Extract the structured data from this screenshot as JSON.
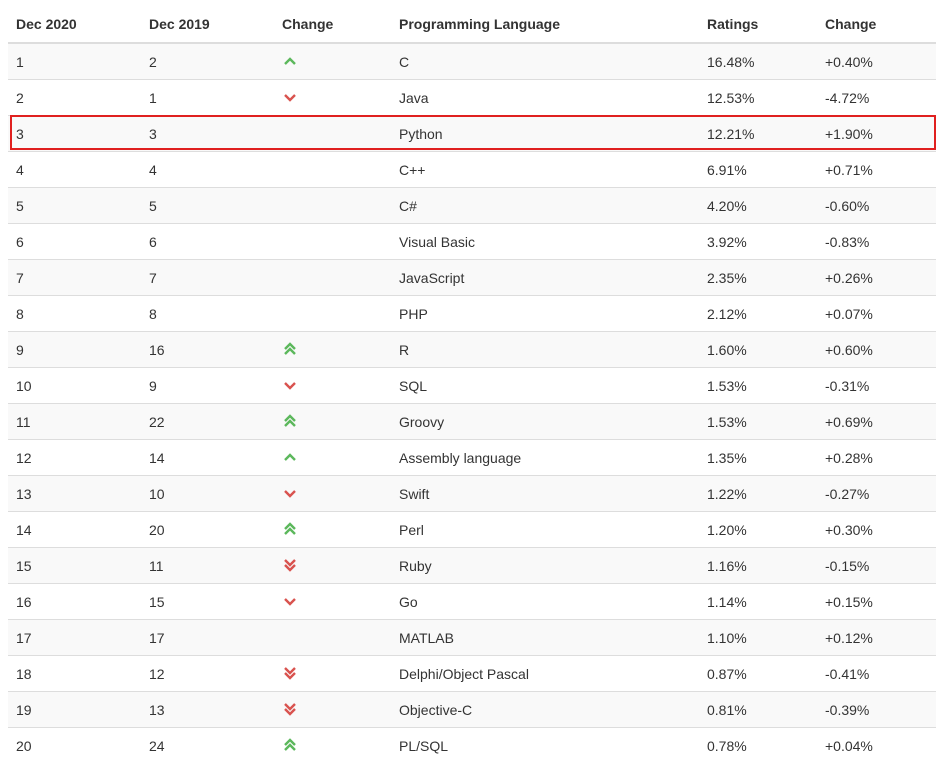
{
  "colors": {
    "up": "#5cb85c",
    "down": "#d9534f",
    "highlight": "#e0201f"
  },
  "headers": [
    "Dec 2020",
    "Dec 2019",
    "Change",
    "Programming Language",
    "Ratings",
    "Change"
  ],
  "rows": [
    {
      "rank2020": "1",
      "rank2019": "2",
      "trend": "up",
      "language": "C",
      "rating": "16.48%",
      "change": "+0.40%"
    },
    {
      "rank2020": "2",
      "rank2019": "1",
      "trend": "down",
      "language": "Java",
      "rating": "12.53%",
      "change": "-4.72%"
    },
    {
      "rank2020": "3",
      "rank2019": "3",
      "trend": "none",
      "language": "Python",
      "rating": "12.21%",
      "change": "+1.90%"
    },
    {
      "rank2020": "4",
      "rank2019": "4",
      "trend": "none",
      "language": "C++",
      "rating": "6.91%",
      "change": "+0.71%"
    },
    {
      "rank2020": "5",
      "rank2019": "5",
      "trend": "none",
      "language": "C#",
      "rating": "4.20%",
      "change": "-0.60%"
    },
    {
      "rank2020": "6",
      "rank2019": "6",
      "trend": "none",
      "language": "Visual Basic",
      "rating": "3.92%",
      "change": "-0.83%"
    },
    {
      "rank2020": "7",
      "rank2019": "7",
      "trend": "none",
      "language": "JavaScript",
      "rating": "2.35%",
      "change": "+0.26%"
    },
    {
      "rank2020": "8",
      "rank2019": "8",
      "trend": "none",
      "language": "PHP",
      "rating": "2.12%",
      "change": "+0.07%"
    },
    {
      "rank2020": "9",
      "rank2019": "16",
      "trend": "up2",
      "language": "R",
      "rating": "1.60%",
      "change": "+0.60%"
    },
    {
      "rank2020": "10",
      "rank2019": "9",
      "trend": "down",
      "language": "SQL",
      "rating": "1.53%",
      "change": "-0.31%"
    },
    {
      "rank2020": "11",
      "rank2019": "22",
      "trend": "up2",
      "language": "Groovy",
      "rating": "1.53%",
      "change": "+0.69%"
    },
    {
      "rank2020": "12",
      "rank2019": "14",
      "trend": "up",
      "language": "Assembly language",
      "rating": "1.35%",
      "change": "+0.28%"
    },
    {
      "rank2020": "13",
      "rank2019": "10",
      "trend": "down",
      "language": "Swift",
      "rating": "1.22%",
      "change": "-0.27%"
    },
    {
      "rank2020": "14",
      "rank2019": "20",
      "trend": "up2",
      "language": "Perl",
      "rating": "1.20%",
      "change": "+0.30%"
    },
    {
      "rank2020": "15",
      "rank2019": "11",
      "trend": "down2",
      "language": "Ruby",
      "rating": "1.16%",
      "change": "-0.15%"
    },
    {
      "rank2020": "16",
      "rank2019": "15",
      "trend": "down",
      "language": "Go",
      "rating": "1.14%",
      "change": "+0.15%"
    },
    {
      "rank2020": "17",
      "rank2019": "17",
      "trend": "none",
      "language": "MATLAB",
      "rating": "1.10%",
      "change": "+0.12%"
    },
    {
      "rank2020": "18",
      "rank2019": "12",
      "trend": "down2",
      "language": "Delphi/Object Pascal",
      "rating": "0.87%",
      "change": "-0.41%"
    },
    {
      "rank2020": "19",
      "rank2019": "13",
      "trend": "down2",
      "language": "Objective-C",
      "rating": "0.81%",
      "change": "-0.39%"
    },
    {
      "rank2020": "20",
      "rank2019": "24",
      "trend": "up2",
      "language": "PL/SQL",
      "rating": "0.78%",
      "change": "+0.04%"
    }
  ],
  "highlighted_row": "3"
}
